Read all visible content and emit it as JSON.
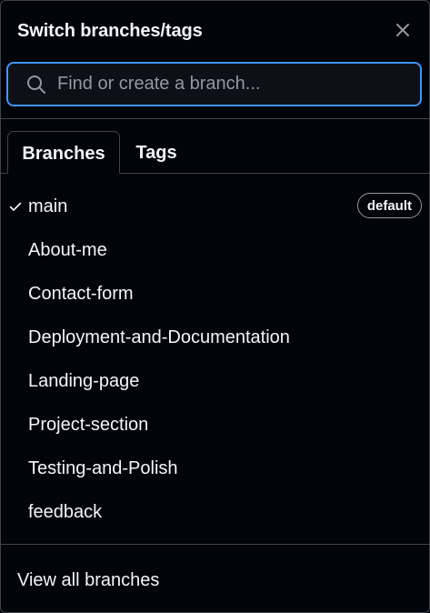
{
  "header": {
    "title": "Switch branches/tags",
    "close_icon": "close-icon"
  },
  "search": {
    "placeholder": "Find or create a branch...",
    "value": "",
    "icon": "search-icon"
  },
  "tabs": [
    {
      "label": "Branches",
      "active": true
    },
    {
      "label": "Tags",
      "active": false
    }
  ],
  "branches": [
    {
      "name": "main",
      "selected": true,
      "badge": "default"
    },
    {
      "name": "About-me"
    },
    {
      "name": "Contact-form"
    },
    {
      "name": "Deployment-and-Documentation"
    },
    {
      "name": "Landing-page"
    },
    {
      "name": "Project-section"
    },
    {
      "name": "Testing-and-Polish"
    },
    {
      "name": "feedback"
    }
  ],
  "footer": {
    "link": "View all branches"
  },
  "colors": {
    "background": "#010409",
    "border": "#3d444d",
    "focus": "#4493f8",
    "text": "#f0f6fc",
    "muted": "#9198a1"
  }
}
